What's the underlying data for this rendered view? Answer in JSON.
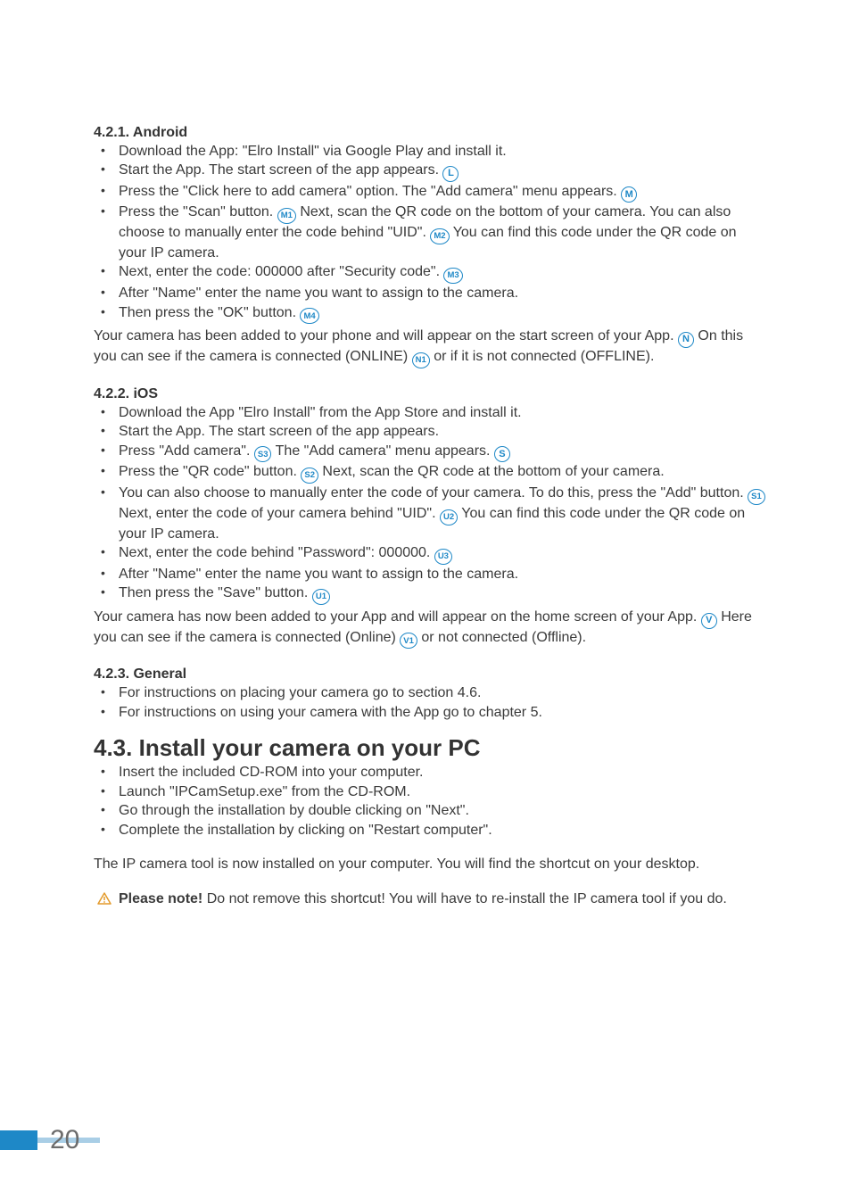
{
  "s421": {
    "title": "4.2.1.  Android",
    "items": [
      [
        {
          "t": "Download the App: \"Elro Install\" via Google Play and install it."
        }
      ],
      [
        {
          "t": "Start the App. The start screen of the app appears. "
        },
        {
          "c": "L"
        }
      ],
      [
        {
          "t": "Press the \"Click here to add camera\" option. The \"Add camera\" menu appears. "
        },
        {
          "c": "M"
        }
      ],
      [
        {
          "t": "Press the \"Scan\" button. "
        },
        {
          "c": "M1"
        },
        {
          "t": " Next, scan the QR code on the bottom of your camera. You can also choose to manually enter the code behind \"UID\". "
        },
        {
          "c": "M2"
        },
        {
          "t": " You can find this code under the QR code on your IP camera."
        }
      ],
      [
        {
          "t": "Next, enter the code: 000000 after \"Security code\". "
        },
        {
          "c": "M3"
        }
      ],
      [
        {
          "t": "After \"Name\" enter the name you want to assign to the camera."
        }
      ],
      [
        {
          "t": "Then press the \"OK\" button. "
        },
        {
          "c": "M4"
        }
      ]
    ],
    "after": [
      {
        "t": "Your camera has been added to your phone and will appear on the start screen of your App. "
      },
      {
        "c": "N"
      },
      {
        "t": " On this you can see if the camera is connected (ONLINE) "
      },
      {
        "c": "N1"
      },
      {
        "t": " or if it is not connected (OFFLINE)."
      }
    ]
  },
  "s422": {
    "title": "4.2.2.  iOS",
    "items": [
      [
        {
          "t": "Download the App \"Elro Install\" from the App Store and install it."
        }
      ],
      [
        {
          "t": "Start the App. The start screen of the app appears."
        }
      ],
      [
        {
          "t": "Press \"Add camera\". "
        },
        {
          "c": "S3"
        },
        {
          "t": " The \"Add camera\" menu appears. "
        },
        {
          "c": "S"
        }
      ],
      [
        {
          "t": "Press the \"QR code\" button. "
        },
        {
          "c": "S2"
        },
        {
          "t": " Next, scan the QR code at the bottom of your camera."
        }
      ],
      [
        {
          "t": "You can also choose to manually enter the code of your camera. To do this, press the \"Add\" button. "
        },
        {
          "c": "S1"
        },
        {
          "t": " Next, enter the code of your camera behind \"UID\". "
        },
        {
          "c": "U2"
        },
        {
          "t": " You can find this code under the QR code on your IP camera."
        }
      ],
      [
        {
          "t": "Next, enter the code behind \"Password\": 000000. "
        },
        {
          "c": "U3"
        }
      ],
      [
        {
          "t": "After \"Name\" enter the name you want to assign to the camera."
        }
      ],
      [
        {
          "t": "Then press the \"Save\" button. "
        },
        {
          "c": "U1"
        }
      ]
    ],
    "after": [
      {
        "t": "Your camera has now been added to your App and will appear on the home screen of your App. "
      },
      {
        "c": "V"
      },
      {
        "t": " Here you can see if the camera is connected (Online) "
      },
      {
        "c": "V1"
      },
      {
        "t": " or not connected (Offline)."
      }
    ]
  },
  "s423": {
    "title": "4.2.3.  General",
    "items": [
      [
        {
          "t": "For instructions on placing your camera go to section 4.6."
        }
      ],
      [
        {
          "t": "For instructions on using your camera with the App go to chapter 5."
        }
      ]
    ]
  },
  "s43": {
    "title": "4.3.  Install your camera on your PC",
    "items": [
      [
        {
          "t": "Insert the included CD-ROM into your computer."
        }
      ],
      [
        {
          "t": "Launch \"IPCamSetup.exe\" from the CD-ROM."
        }
      ],
      [
        {
          "t": "Go through the installation by double clicking on \"Next\"."
        }
      ],
      [
        {
          "t": "Complete the installation by clicking on \"Restart computer\"."
        }
      ]
    ],
    "after_plain": "The IP camera tool is now installed on your computer. You will find the shortcut on your desktop."
  },
  "note": {
    "bold": "Please note!",
    "rest": " Do not remove this shortcut! You will have to re-install the IP camera tool if you do."
  },
  "page_number": "20"
}
